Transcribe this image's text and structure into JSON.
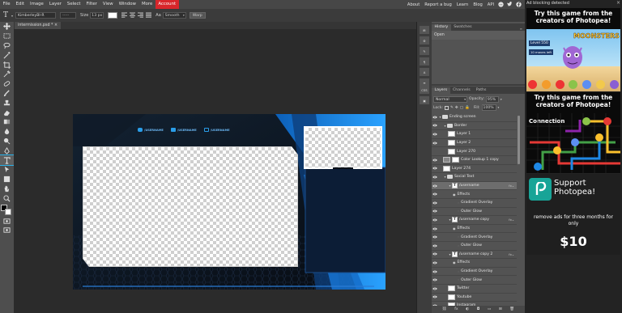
{
  "menu": {
    "items": [
      "File",
      "Edit",
      "Image",
      "Layer",
      "Select",
      "Filter",
      "View",
      "Window",
      "More",
      "Account"
    ],
    "active": "Account",
    "right_links": [
      "About",
      "Report a bug",
      "Learn",
      "Blog",
      "API"
    ]
  },
  "options": {
    "font_name": "KimberleyBl-R",
    "font_style": "-----",
    "size_label": "Size",
    "size_value": "13 px",
    "aa_label": "Aa",
    "antialias": "Smooth",
    "warp_label": "Warp"
  },
  "document": {
    "tab_title": "intermission.psd *"
  },
  "canvas": {
    "social_handles": [
      "/USERNAME",
      "/USERNAME",
      "/USERNAME"
    ],
    "colors": {
      "accent": "#1e8ff0",
      "dark": "#0b1119"
    }
  },
  "history_panel": {
    "tabs": [
      "History",
      "Swatches"
    ],
    "entries": [
      "Open"
    ]
  },
  "layers_panel": {
    "tabs": [
      "Layers",
      "Channels",
      "Paths"
    ],
    "blend_mode": "Normal",
    "opacity_label": "Opacity:",
    "opacity_value": "95%",
    "lock_label": "Lock:",
    "fill_label": "Fill:",
    "fill_value": "100%",
    "rows": [
      {
        "label": "Ending screen",
        "kind": "group",
        "indent": 0,
        "visible": true
      },
      {
        "label": "Border",
        "kind": "group",
        "indent": 1,
        "visible": true
      },
      {
        "label": "Layer 1",
        "kind": "layer",
        "indent": 2,
        "visible": true
      },
      {
        "label": "Layer 2",
        "kind": "layer",
        "indent": 2,
        "visible": true
      },
      {
        "label": "Layer 270",
        "kind": "layer",
        "indent": 2,
        "visible": false
      },
      {
        "label": "Color Lookup 1 copy",
        "kind": "adjust",
        "indent": 1,
        "visible": true
      },
      {
        "label": "Layer 274",
        "kind": "layer",
        "indent": 1,
        "visible": true
      },
      {
        "label": "Social Text",
        "kind": "group",
        "indent": 1,
        "visible": true
      },
      {
        "label": "/username",
        "kind": "text",
        "indent": 2,
        "visible": true,
        "fx": true,
        "selected": true
      },
      {
        "label": "Effects",
        "kind": "effects",
        "indent": 3,
        "visible": true
      },
      {
        "label": "Gradient Overlay",
        "kind": "effect",
        "indent": 4,
        "visible": true
      },
      {
        "label": "Outer Glow",
        "kind": "effect",
        "indent": 4,
        "visible": true
      },
      {
        "label": "/username copy",
        "kind": "text",
        "indent": 2,
        "visible": true,
        "fx": true
      },
      {
        "label": "Effects",
        "kind": "effects",
        "indent": 3,
        "visible": true
      },
      {
        "label": "Gradient Overlay",
        "kind": "effect",
        "indent": 4,
        "visible": true
      },
      {
        "label": "Outer Glow",
        "kind": "effect",
        "indent": 4,
        "visible": true
      },
      {
        "label": "/username copy 2",
        "kind": "text",
        "indent": 2,
        "visible": true,
        "fx": true
      },
      {
        "label": "Effects",
        "kind": "effects",
        "indent": 3,
        "visible": true
      },
      {
        "label": "Gradient Overlay",
        "kind": "effect",
        "indent": 4,
        "visible": true
      },
      {
        "label": "Outer Glow",
        "kind": "effect",
        "indent": 4,
        "visible": true
      },
      {
        "label": "Twitter",
        "kind": "layer",
        "indent": 2,
        "visible": true
      },
      {
        "label": "Youtube",
        "kind": "layer",
        "indent": 2,
        "visible": true
      },
      {
        "label": "Instagram",
        "kind": "layer",
        "indent": 2,
        "visible": true
      }
    ]
  },
  "ad": {
    "notice": "Ad blocking detected",
    "ad1": {
      "headline": "Try this game from the creators of Photopea!",
      "game_title": "MOONSTERS",
      "level": "Level 550",
      "moves": "10 moves left"
    },
    "ad2": {
      "headline": "Try this game from the creators of Photopea!",
      "game_title": "Connection"
    },
    "ad3": {
      "headline": "Support Photopea!",
      "body": "remove ads for three months for only",
      "price": "$10"
    }
  }
}
